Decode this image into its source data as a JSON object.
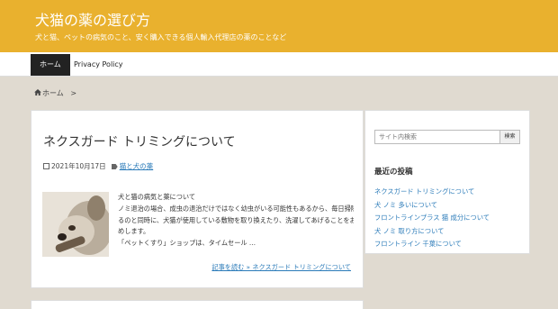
{
  "header": {
    "title": "犬猫の薬の選び方",
    "description": "犬と猫、ペットの病気のこと、安く購入できる個人輸入代理店の薬のことなど"
  },
  "nav": {
    "items": [
      {
        "label": "ホーム"
      },
      {
        "label": "Privacy Policy"
      }
    ]
  },
  "breadcrumb": {
    "home": "ホーム",
    "separator": ">"
  },
  "post": {
    "title": "ネクスガード トリミングについて",
    "date": "2021年10月17日",
    "category": "猫と犬の薬",
    "excerpt": [
      "犬と猫の病気と薬について",
      "ノミ退治の場合、成虫の退治だけではなく幼虫がいる可能性もあるから、毎日掃除す",
      "るのと同時に、犬猫が使用している敷物を取り換えたり、洗濯してあげることをおすす",
      "めします。",
      "「ペットくすり」ショップは、タイムセール …"
    ],
    "read_more": "記事を読む »  ネクスガード トリミングについて"
  },
  "sidebar": {
    "search_placeholder": "サイト内検索",
    "search_button": "検索",
    "recent_title": "最近の投稿",
    "recent_posts": [
      "ネクスガード トリミングについて",
      "犬 ノミ 多いについて",
      "フロントラインプラス 猫 成分について",
      "犬 ノミ 取り方について",
      "フロントライン 千葉について"
    ]
  },
  "colors": {
    "header_bg": "#e9b12e",
    "link": "#2b7bb9",
    "page_bg": "#e0dad0"
  }
}
